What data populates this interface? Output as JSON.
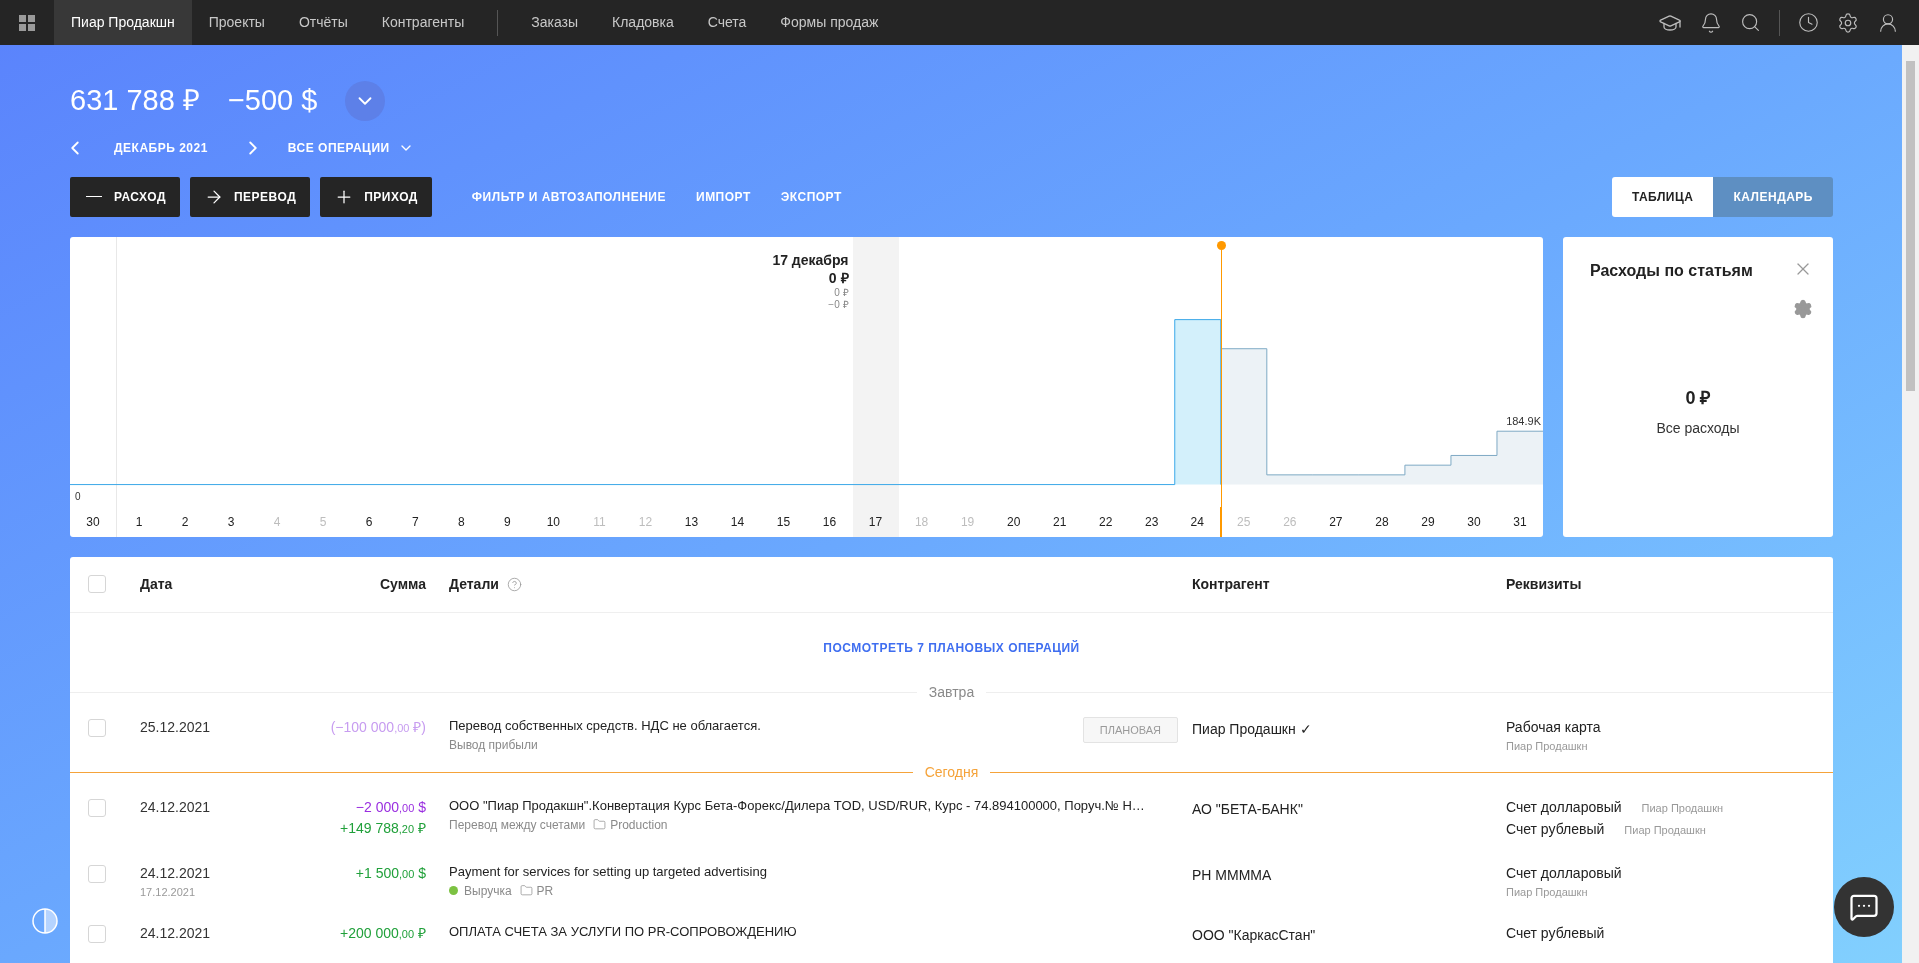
{
  "nav": {
    "primary": [
      {
        "label": "Пиар Продакшн",
        "selected": true
      },
      {
        "label": "Проекты",
        "selected": false
      },
      {
        "label": "Отчёты",
        "selected": false
      },
      {
        "label": "Контрагенты",
        "selected": false
      }
    ],
    "secondary": [
      {
        "label": "Заказы",
        "selected": false
      },
      {
        "label": "Кладовка",
        "selected": false
      },
      {
        "label": "Счета",
        "selected": false
      },
      {
        "label": "Формы продаж",
        "selected": false
      }
    ]
  },
  "balances": [
    "631 788 ₽",
    "−500 $"
  ],
  "period": "ДЕКАБРЬ 2021",
  "filter": "ВСЕ ОПЕРАЦИИ",
  "actions": [
    {
      "label": "РАСХОД",
      "kind": "minus"
    },
    {
      "label": "ПЕРЕВОД",
      "kind": "arrow"
    },
    {
      "label": "ПРИХОД",
      "kind": "plus"
    }
  ],
  "links": [
    "ФИЛЬТР И АВТОЗАПОЛНЕНИЕ",
    "ИМПОРТ",
    "ЭКСПОРТ"
  ],
  "view_tabs": [
    {
      "label": "ТАБЛИЦА",
      "selected": true
    },
    {
      "label": "КАЛЕНДАРЬ",
      "selected": false
    }
  ],
  "chart": {
    "tooltip": {
      "date": "17 декабря",
      "total": "0 ₽",
      "line_1": "0 ₽",
      "line_2": "−0 ₽"
    },
    "zero_label": "0",
    "peak_label": "184.9K",
    "days": [
      {
        "label": "30",
        "muted": false,
        "selected": false,
        "today": false
      },
      {
        "label": "1",
        "muted": false,
        "selected": false,
        "today": false
      },
      {
        "label": "2",
        "muted": false,
        "selected": false,
        "today": false
      },
      {
        "label": "3",
        "muted": false,
        "selected": false,
        "today": false
      },
      {
        "label": "4",
        "muted": true,
        "selected": false,
        "today": false
      },
      {
        "label": "5",
        "muted": true,
        "selected": false,
        "today": false
      },
      {
        "label": "6",
        "muted": false,
        "selected": false,
        "today": false
      },
      {
        "label": "7",
        "muted": false,
        "selected": false,
        "today": false
      },
      {
        "label": "8",
        "muted": false,
        "selected": false,
        "today": false
      },
      {
        "label": "9",
        "muted": false,
        "selected": false,
        "today": false
      },
      {
        "label": "10",
        "muted": false,
        "selected": false,
        "today": false
      },
      {
        "label": "11",
        "muted": true,
        "selected": false,
        "today": false
      },
      {
        "label": "12",
        "muted": true,
        "selected": false,
        "today": false
      },
      {
        "label": "13",
        "muted": false,
        "selected": false,
        "today": false
      },
      {
        "label": "14",
        "muted": false,
        "selected": false,
        "today": false
      },
      {
        "label": "15",
        "muted": false,
        "selected": false,
        "today": false
      },
      {
        "label": "16",
        "muted": false,
        "selected": false,
        "today": false
      },
      {
        "label": "17",
        "muted": false,
        "selected": true,
        "today": false
      },
      {
        "label": "18",
        "muted": true,
        "selected": false,
        "today": false
      },
      {
        "label": "19",
        "muted": true,
        "selected": false,
        "today": false
      },
      {
        "label": "20",
        "muted": false,
        "selected": false,
        "today": false
      },
      {
        "label": "21",
        "muted": false,
        "selected": false,
        "today": false
      },
      {
        "label": "22",
        "muted": false,
        "selected": false,
        "today": false
      },
      {
        "label": "23",
        "muted": false,
        "selected": false,
        "today": false
      },
      {
        "label": "24",
        "muted": false,
        "selected": false,
        "today": true
      },
      {
        "label": "25",
        "muted": true,
        "selected": false,
        "today": false
      },
      {
        "label": "26",
        "muted": true,
        "selected": false,
        "today": false
      },
      {
        "label": "27",
        "muted": false,
        "selected": false,
        "today": false
      },
      {
        "label": "28",
        "muted": false,
        "selected": false,
        "today": false
      },
      {
        "label": "29",
        "muted": false,
        "selected": false,
        "today": false
      },
      {
        "label": "30",
        "muted": false,
        "selected": false,
        "today": false
      },
      {
        "label": "31",
        "muted": false,
        "selected": false,
        "today": false
      }
    ]
  },
  "expenses_panel": {
    "title": "Расходы по статьям",
    "amount": "0 ₽",
    "caption": "Все расходы"
  },
  "table": {
    "header_checked": false,
    "columns": [
      "Дата",
      "Сумма",
      "Детали",
      "Контрагент",
      "Реквизиты"
    ],
    "planned_link": "ПОСМОТРЕТЬ 7 ПЛАНОВЫХ ОПЕРАЦИЙ",
    "groups": [
      {
        "label": "Завтра",
        "kind": "tomorrow",
        "rows": [
          {
            "checked": false,
            "date": "25.12.2021",
            "amounts": [
              {
                "kind": "planned",
                "main": "(−100 000",
                "cents": ",00",
                "suffix": " ₽)"
              }
            ],
            "title": "Перевод собственных средств. НДС не облагается.",
            "category": {
              "label": "Вывод прибыли"
            },
            "badge": "ПЛАНОВАЯ",
            "counterparty": "Пиар Продашкн ✓",
            "requisites": [
              {
                "account": "Рабочая карта",
                "owner": "Пиар Продашкн"
              }
            ]
          }
        ]
      },
      {
        "label": "Сегодня",
        "kind": "today",
        "rows": [
          {
            "checked": false,
            "date": "24.12.2021",
            "amounts": [
              {
                "kind": "expense",
                "main": "−2 000",
                "cents": ",00",
                "suffix": " $"
              },
              {
                "kind": "income",
                "main": "+149 788",
                "cents": ",20",
                "suffix": " ₽"
              }
            ],
            "title": "ООО \"Пиар Продакшн\".Конвертация Курс Бета-Форекс/Дилера TOD, USD/RUR, Курс - 74.894100000, Поруч.№ Н…",
            "category": {
              "label": "Перевод между счетами"
            },
            "folder": "Production",
            "counterparty": "АО \"БЕТА-БАНК\"",
            "requisites": [
              {
                "account": "Счет долларовый",
                "owner": "Пиар Продашкн"
              },
              {
                "account": "Счет рублевый",
                "owner": "Пиар Продашкн"
              }
            ]
          },
          {
            "checked": false,
            "date": "24.12.2021",
            "date_2": "17.12.2021",
            "amounts": [
              {
                "kind": "income",
                "main": "+1 500",
                "cents": ",00",
                "suffix": " $"
              }
            ],
            "title": "Payment for services for setting up targeted advertising",
            "category": {
              "label": "Выручка",
              "color": "#7cc242"
            },
            "folder": "PR",
            "counterparty": "PH MMMMA",
            "requisites": [
              {
                "account": "Счет долларовый",
                "owner": "Пиар Продашкн"
              }
            ]
          },
          {
            "checked": false,
            "date": "24.12.2021",
            "amounts": [
              {
                "kind": "income",
                "main": "+200 000",
                "cents": ",00",
                "suffix": " ₽"
              }
            ],
            "title": "ОПЛАТА СЧЕТА ЗА УСЛУГИ ПО PR-СОПРОВОЖДЕНИЮ",
            "counterparty": "ООО \"КаркасСтан\"",
            "requisites": [
              {
                "account": "Счет рублевый"
              }
            ]
          }
        ]
      }
    ]
  }
}
